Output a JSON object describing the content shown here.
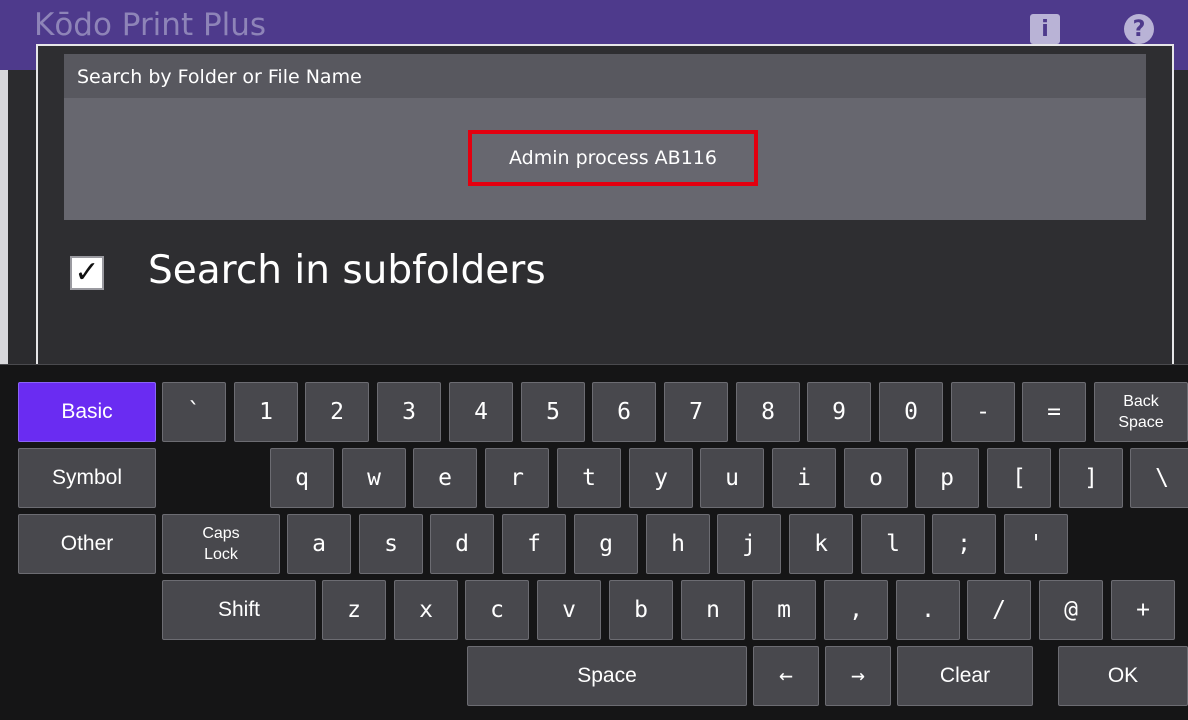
{
  "app": {
    "title": "Kōdo Print Plus",
    "info_icon": "i",
    "help_icon": "?"
  },
  "dialog": {
    "search_label": "Search by Folder or File Name",
    "search_value": "Admin process AB116",
    "subfolders_checked": true,
    "subfolders_label": "Search in subfolders",
    "check_glyph": "✓"
  },
  "keyboard": {
    "modes": [
      "Basic",
      "Symbol",
      "Other"
    ],
    "active_mode": "Basic",
    "row1": [
      "`",
      "1",
      "2",
      "3",
      "4",
      "5",
      "6",
      "7",
      "8",
      "9",
      "0",
      "-",
      "="
    ],
    "backspace": [
      "Back",
      "Space"
    ],
    "row2": [
      "q",
      "w",
      "e",
      "r",
      "t",
      "y",
      "u",
      "i",
      "o",
      "p",
      "[",
      "]",
      "\\"
    ],
    "caps_lock": [
      "Caps",
      "Lock"
    ],
    "row3": [
      "a",
      "s",
      "d",
      "f",
      "g",
      "h",
      "j",
      "k",
      "l",
      ";",
      "'"
    ],
    "shift": "Shift",
    "row4": [
      "z",
      "x",
      "c",
      "v",
      "b",
      "n",
      "m",
      ",",
      ".",
      "/",
      "@",
      "+"
    ],
    "space": "Space",
    "arrow_left": "←",
    "arrow_right": "→",
    "clear": "Clear",
    "ok": "OK"
  },
  "colors": {
    "header": "#4e3a8c",
    "active_mode": "#6a2cf2",
    "highlight_border": "#e3000f"
  }
}
